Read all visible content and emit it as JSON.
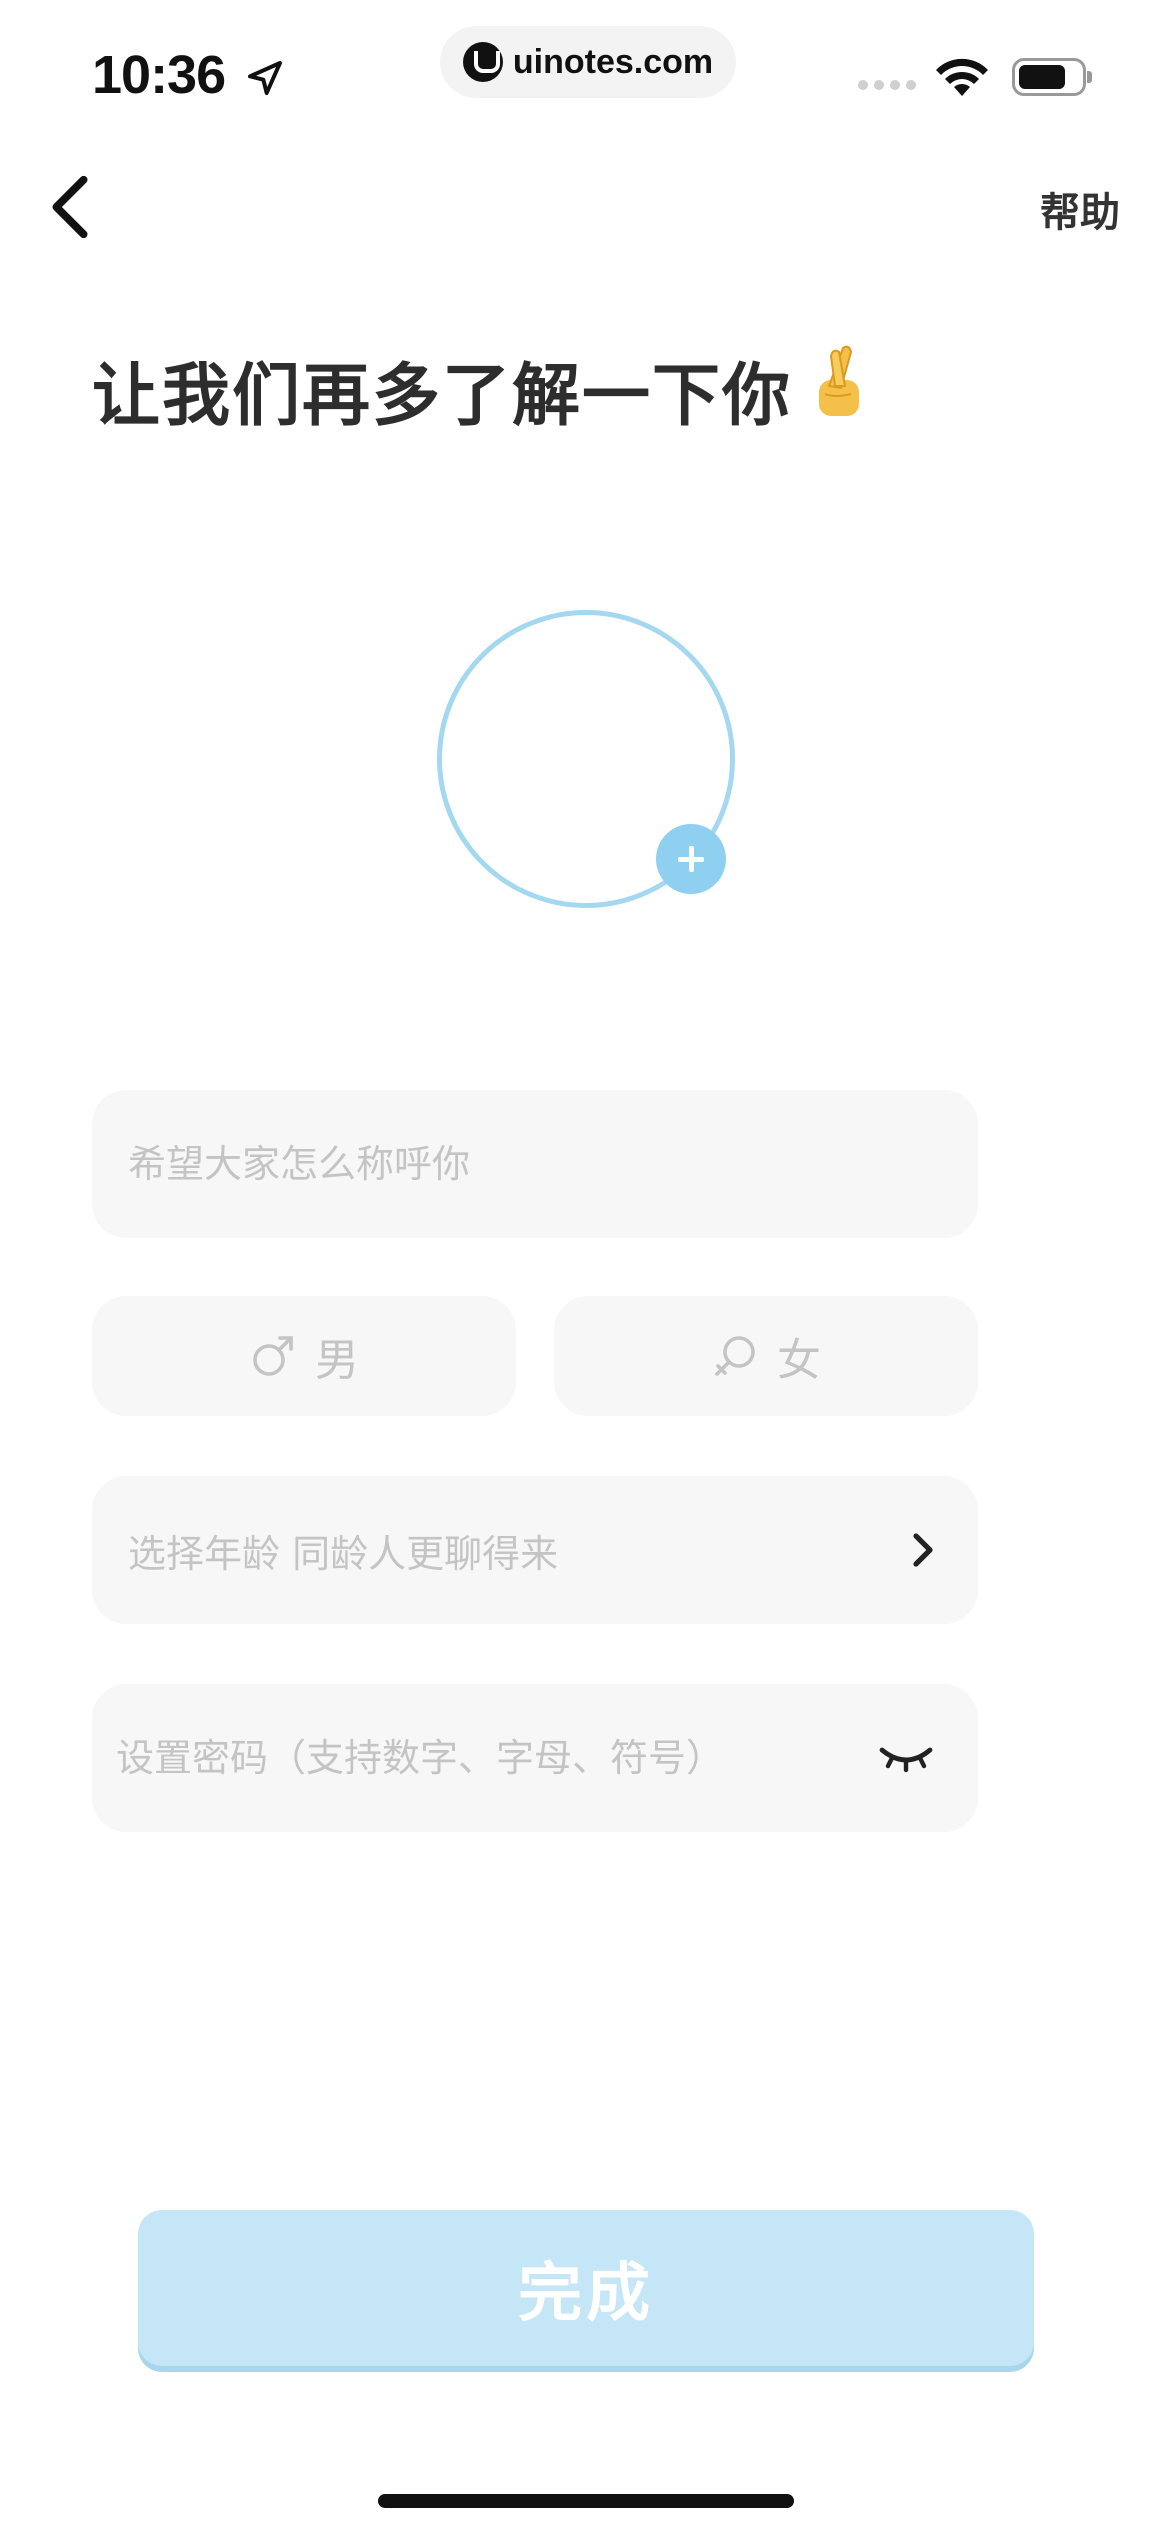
{
  "status_bar": {
    "time": "10:36",
    "url": "uinotes.com"
  },
  "nav": {
    "help_label": "帮助"
  },
  "title": "让我们再多了解一下你",
  "form": {
    "nickname_placeholder": "希望大家怎么称呼你",
    "gender_male_label": "男",
    "gender_female_label": "女",
    "age_placeholder": "选择年龄 同龄人更聊得来",
    "password_placeholder": "设置密码（支持数字、字母、符号）"
  },
  "done_label": "完成",
  "colors": {
    "accent": "#8fd0f1",
    "avatar_ring": "#a4d8f0",
    "button": "#c4e6f7",
    "field_bg": "#f7f7f7",
    "placeholder": "#c4c4c4"
  }
}
